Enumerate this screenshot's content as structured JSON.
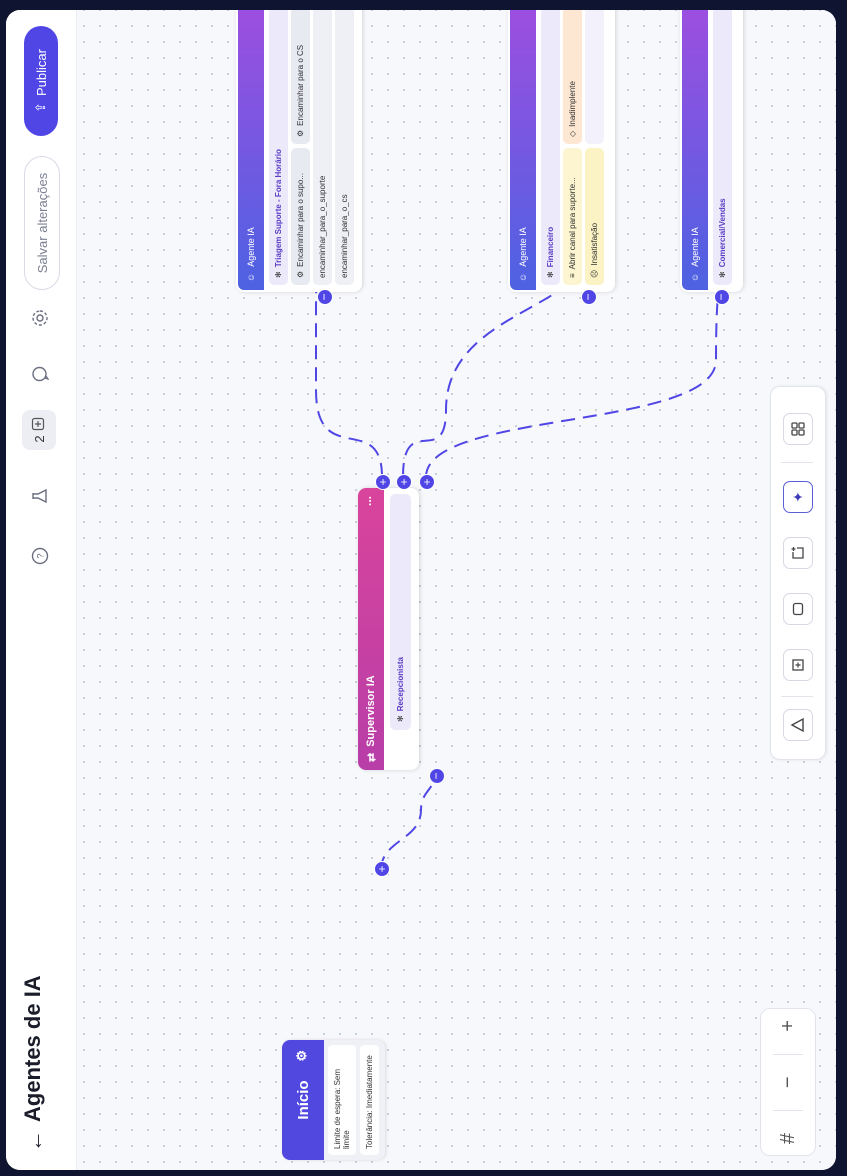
{
  "header": {
    "back_icon": "arrow-left-icon",
    "title": "Agentes de IA",
    "version_count": "2",
    "save_label": "Salvar alterações",
    "publish_label": "Publicar"
  },
  "start_node": {
    "title": "Início",
    "wait_limit": "Limite de espera: Sem limite",
    "tolerance": "Tolerância: Imediatamente"
  },
  "supervisor": {
    "title": "Supervisor IA",
    "menu": "...",
    "agent": "Recepcionista"
  },
  "agents": [
    {
      "header": "Agente IA",
      "name": "Triagem Suporte - Fora Horário",
      "actions": [
        "Encaminhar para o supo...",
        "Encaminhar para o CS"
      ],
      "routes": [
        "encaminhar_para_o_suporte",
        "encaminhar_para_o_cs"
      ]
    },
    {
      "header": "Agente IA",
      "name": "Financeiro",
      "actions": [
        "Abrir canal para suporte...",
        "Inadimplente"
      ],
      "extra": "Insatisfação"
    },
    {
      "header": "Agente IA",
      "name": "Comercial/Vendas"
    }
  ],
  "toolbar": {
    "tools": [
      "triangle-icon",
      "frame-icon",
      "rectangle-icon",
      "add-note-icon",
      "ai-sparkle-icon",
      "grid-icon"
    ]
  },
  "zoom": {
    "zoom_in": "+",
    "zoom_out": "−",
    "fit": "#"
  }
}
